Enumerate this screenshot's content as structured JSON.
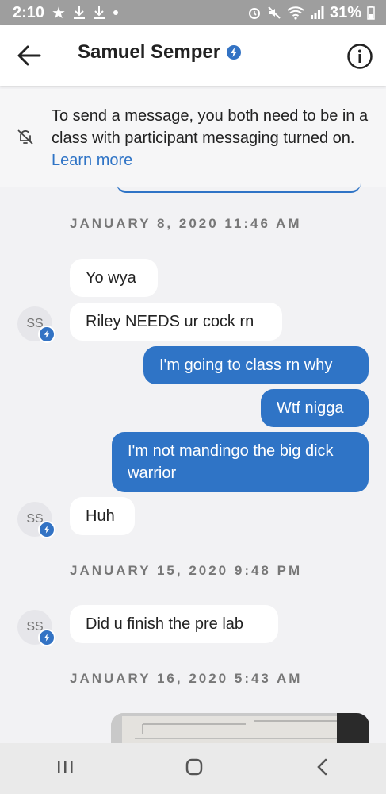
{
  "status_bar": {
    "time": "2:10",
    "battery": "31%"
  },
  "header": {
    "contact_name": "Samuel Semper"
  },
  "notice": {
    "text": "To send a message, you both need to be in a class with participant messaging turned on.",
    "link": "Learn more"
  },
  "conversation": {
    "date_1": "JANUARY 8, 2020 11:46 AM",
    "msg_1": "Yo wya",
    "msg_2": "Riley NEEDS ur cock rn",
    "msg_3": "I'm going to class rn why",
    "msg_4": "Wtf nigga",
    "msg_5": "I'm not mandingo the big dick warrior",
    "msg_6": "Huh",
    "date_2": "JANUARY 15, 2020 9:48 PM",
    "msg_7": "Did u finish the pre lab",
    "date_3": "JANUARY 16, 2020 5:43 AM",
    "avatar_initials": "SS"
  },
  "colors": {
    "accent": "#2f74c6",
    "incoming_bubble": "#ffffff",
    "background": "#f2f2f4"
  }
}
